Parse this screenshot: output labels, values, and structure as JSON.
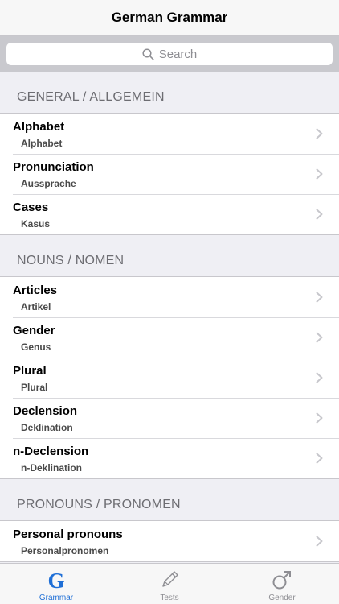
{
  "nav": {
    "title": "German Grammar"
  },
  "search": {
    "placeholder": "Search"
  },
  "sections": [
    {
      "header": "GENERAL / ALLGEMEIN",
      "items": [
        {
          "title": "Alphabet",
          "subtitle": "Alphabet"
        },
        {
          "title": "Pronunciation",
          "subtitle": "Aussprache"
        },
        {
          "title": "Cases",
          "subtitle": "Kasus"
        }
      ]
    },
    {
      "header": "NOUNS / NOMEN",
      "items": [
        {
          "title": "Articles",
          "subtitle": "Artikel"
        },
        {
          "title": "Gender",
          "subtitle": "Genus"
        },
        {
          "title": "Plural",
          "subtitle": "Plural"
        },
        {
          "title": "Declension",
          "subtitle": "Deklination"
        },
        {
          "title": "n-Declension",
          "subtitle": "n-Deklination"
        }
      ]
    },
    {
      "header": "PRONOUNS / PRONOMEN",
      "items": [
        {
          "title": "Personal pronouns",
          "subtitle": "Personalpronomen"
        }
      ]
    }
  ],
  "tabs": [
    {
      "label": "Grammar",
      "icon": "grammar-g-icon",
      "active": true
    },
    {
      "label": "Tests",
      "icon": "pencil-icon",
      "active": false
    },
    {
      "label": "Gender",
      "icon": "male-symbol-icon",
      "active": false
    }
  ],
  "colors": {
    "accent": "#1f6fd6",
    "inactive": "#8e8e93",
    "chevron": "#c7c7cc"
  }
}
